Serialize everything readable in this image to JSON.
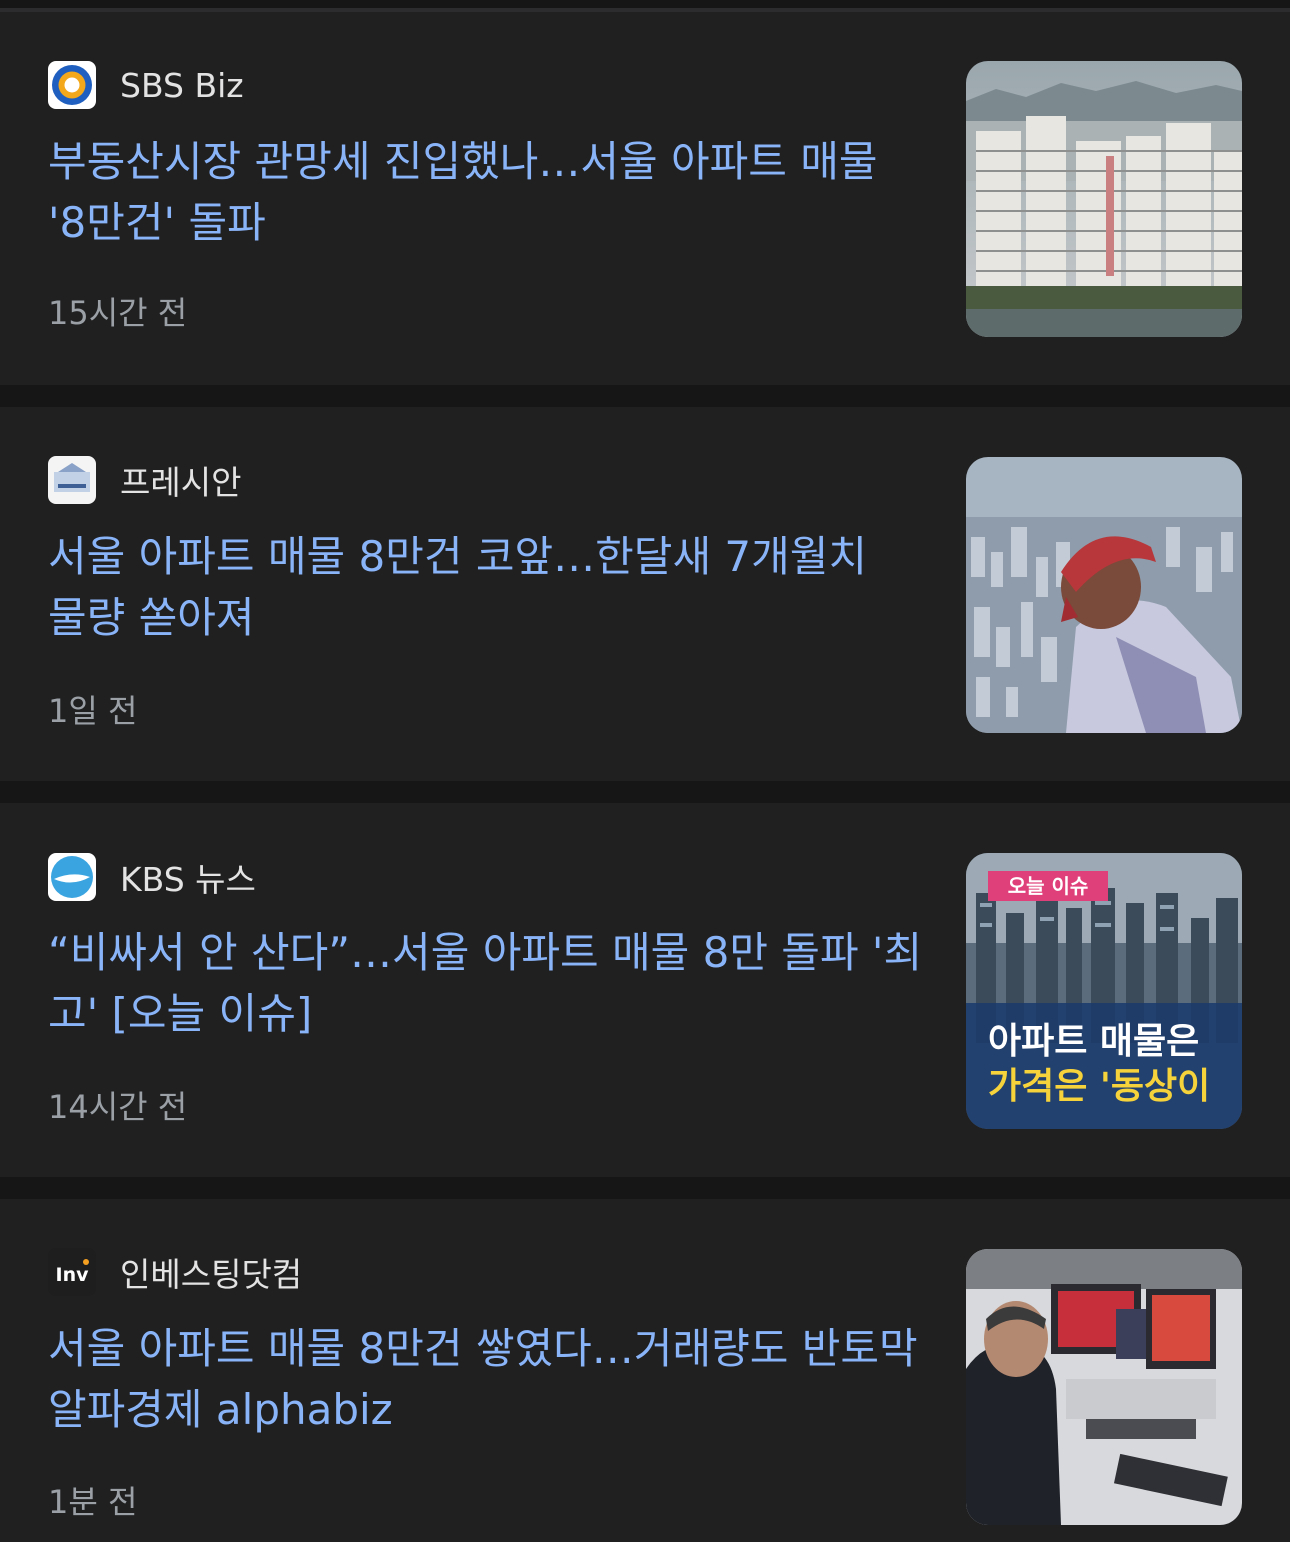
{
  "articles": [
    {
      "source": "SBS Biz",
      "logo": "sbs-biz-logo",
      "headline": "부동산시장 관망세 진입했나…서울 아파트 매물 '8만건' 돌파",
      "time": "15시간 전",
      "thumbnail": "apartment-buildings-photo"
    },
    {
      "source": "프레시안",
      "logo": "pressian-logo",
      "headline": "서울 아파트 매물 8만건 코앞…한달새 7개월치 물량 쏟아져",
      "time": "1일 전",
      "thumbnail": "man-overlooking-city-photo"
    },
    {
      "source": "KBS 뉴스",
      "logo": "kbs-news-logo",
      "headline": "“비싸서 안 산다”…서울 아파트 매물 8만 돌파 '최고' [오늘 이슈]",
      "time": "14시간 전",
      "thumbnail": "news-broadcast-still",
      "thumbnail_badge": "오늘 이슈",
      "thumbnail_caption_1": "아파트 매물은",
      "thumbnail_caption_2": "가격은 '동상이"
    },
    {
      "source": "인베스팅닷컴",
      "logo": "investing-com-logo",
      "logo_text": "Inv",
      "headline": "서울 아파트 매물 8만건 쌓였다…거래량도 반토막 알파경제 alphabiz",
      "time": "1분 전",
      "thumbnail": "stock-trader-monitors-photo"
    }
  ],
  "colors": {
    "background": "#161616",
    "card": "#202021",
    "headline": "#8ab4f8",
    "source": "#e3e3e3",
    "time": "#9aa0a6"
  }
}
